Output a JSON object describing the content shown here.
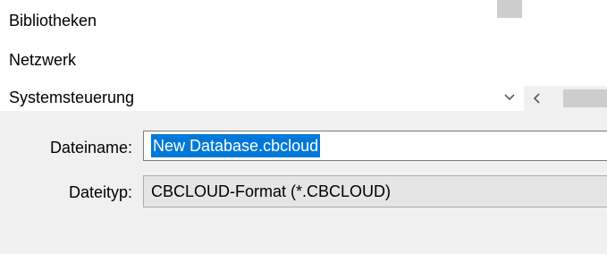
{
  "navigation": {
    "items": [
      {
        "label": "Bibliotheken"
      },
      {
        "label": "Netzwerk"
      },
      {
        "label": "Systemsteuerung"
      }
    ]
  },
  "icons": {
    "scroll_down": "chevron-down-icon",
    "scroll_left": "chevron-left-icon"
  },
  "form": {
    "filename_label": "Dateiname:",
    "filename_value": "New Database.cbcloud",
    "filetype_label": "Dateityp:",
    "filetype_value": "CBCLOUD-Format (*.CBCLOUD)"
  },
  "colors": {
    "selection": "#0078d7",
    "background": "#f0f0f0"
  }
}
